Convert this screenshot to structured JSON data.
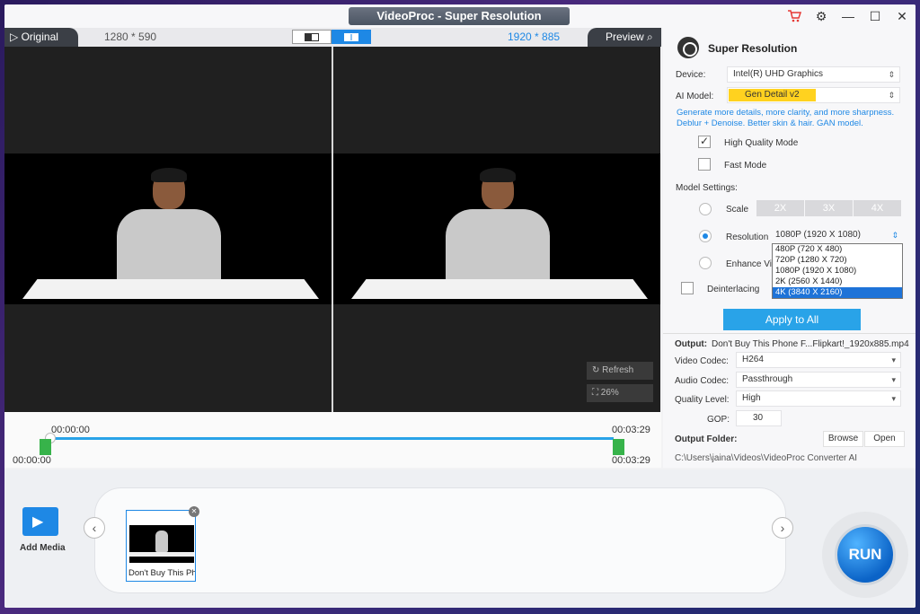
{
  "window": {
    "title": "VideoProc - Super Resolution"
  },
  "titlebar": {
    "cart_icon": "cart-icon",
    "settings_icon": "gear-icon",
    "minimize": "—",
    "maximize": "☐",
    "close": "✕"
  },
  "preview": {
    "original_label": "Original",
    "original_res": "1280 * 590",
    "output_res": "1920 * 885",
    "preview_label": "Preview",
    "refresh_label": "Refresh",
    "zoom_label": "26%"
  },
  "timeline": {
    "start_top": "00:00:00",
    "end_top": "00:03:29",
    "start_bottom": "00:00:00",
    "end_bottom": "00:03:29"
  },
  "panel": {
    "title": "Super Resolution",
    "device_label": "Device:",
    "device_value": "Intel(R) UHD Graphics",
    "ai_model_label": "AI Model:",
    "ai_model_value": "Gen Detail v2",
    "description": "Generate more details, more clarity, and more sharpness. Deblur + Denoise. Better skin & hair. GAN model.",
    "high_quality_label": "High Quality Mode",
    "fast_mode_label": "Fast Mode",
    "model_settings_label": "Model Settings:",
    "scale_label": "Scale",
    "scale_options": [
      "2X",
      "3X",
      "4X"
    ],
    "resolution_label": "Resolution",
    "resolution_value": "1080P (1920 X 1080)",
    "resolution_options": [
      "480P (720 X 480)",
      "720P (1280 X 720)",
      "1080P (1920 X 1080)",
      "2K (2560 X 1440)",
      "4K (3840 X 2160)"
    ],
    "enhance_label": "Enhance Vid",
    "deinterlacing_label": "Deinterlacing",
    "apply_all": "Apply to All",
    "output_label": "Output:",
    "output_value": "Don't Buy This Phone F...Flipkart!_1920x885.mp4",
    "video_codec_label": "Video Codec:",
    "video_codec_value": "H264",
    "audio_codec_label": "Audio Codec:",
    "audio_codec_value": "Passthrough",
    "quality_label": "Quality Level:",
    "quality_value": "High",
    "gop_label": "GOP:",
    "gop_value": "30",
    "output_folder_label": "Output Folder:",
    "browse_label": "Browse",
    "open_label": "Open",
    "folder_path": "C:\\Users\\jaina\\Videos\\VideoProc Converter AI"
  },
  "bottom": {
    "add_media_label": "Add Media",
    "thumb_label": "Don't Buy This Ph",
    "run_label": "RUN"
  },
  "colors": {
    "accent": "#29a3e8",
    "highlight": "#ffd21f",
    "timeline_handle": "#37b34a"
  }
}
